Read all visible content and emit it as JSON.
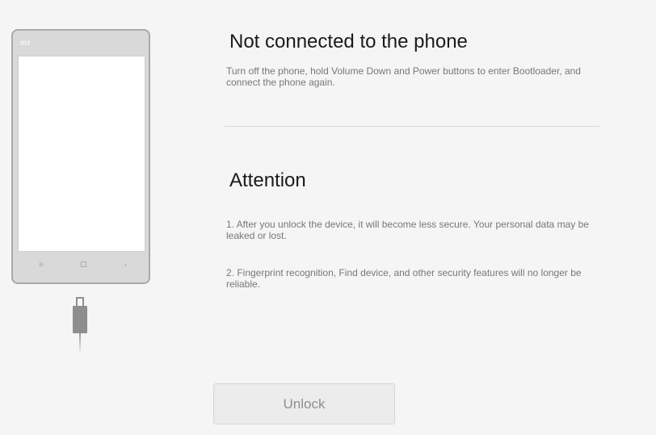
{
  "phone": {
    "logo": "mi",
    "nav_menu_glyph": "≡",
    "nav_back_glyph": "‹"
  },
  "status": {
    "title": "Not connected to the phone",
    "description": "Turn off the phone, hold Volume Down and Power buttons to enter Bootloader, and connect the phone again."
  },
  "attention": {
    "title": "Attention",
    "notes": [
      "1. After you unlock the device, it will become less secure. Your personal data may be leaked or lost.",
      "2. Fingerprint recognition, Find device, and other security features will no longer be reliable."
    ]
  },
  "actions": {
    "unlock_label": "Unlock",
    "unlock_enabled": false
  },
  "colors": {
    "background": "#f5f5f5",
    "heading": "#1b1b1b",
    "body_text": "#777777",
    "button_disabled_bg": "#ececec",
    "button_disabled_text": "#8f8f8f"
  },
  "icons": [
    "phone-illustration-icon",
    "usb-cable-icon",
    "menu-icon",
    "home-icon",
    "back-icon"
  ]
}
